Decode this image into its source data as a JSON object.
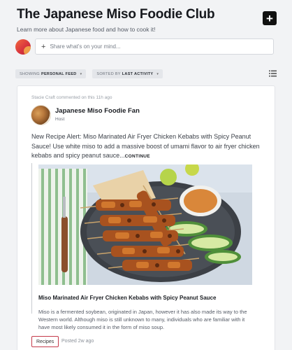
{
  "header": {
    "title": "The Japanese Miso Foodie Club",
    "subtitle": "Learn more about Japanese food and how to cook it!",
    "add_label": "+"
  },
  "composer": {
    "plus": "+",
    "placeholder": "Share what's on your mind..."
  },
  "filters": {
    "feed_prefix": "SHOWING",
    "feed_value": "PERSONAL FEED",
    "sort_prefix": "SORTED BY",
    "sort_value": "LAST ACTIVITY",
    "caret": "▾"
  },
  "post": {
    "activity": "Stacie Craft commented on this 11h ago",
    "author": "Japanese Miso Foodie Fan",
    "role": "Host",
    "text": "New Recipe Alert: Miso Marinated Air Fryer Chicken Kebabs with Spicy Peanut Sauce! Use white miso to add a massive boost of umami flavor to air fryer chicken kebabs and spicy peanut sauce...",
    "continue_label": "CONTINUE",
    "embed": {
      "title": "Miso Marinated Air Fryer Chicken Kebabs with Spicy Peanut Sauce",
      "description": "Miso is a fermented soybean, originated in Japan, however it has also made its way to the Western world. Although miso is still unknown to many, individuals who are familiar with it have most likely consumed it in the form of miso soup."
    },
    "tag": "Recipes",
    "posted": "Posted 2w ago"
  },
  "colors": {
    "tag_border": "#c43a4a",
    "add_button": "#111111"
  }
}
